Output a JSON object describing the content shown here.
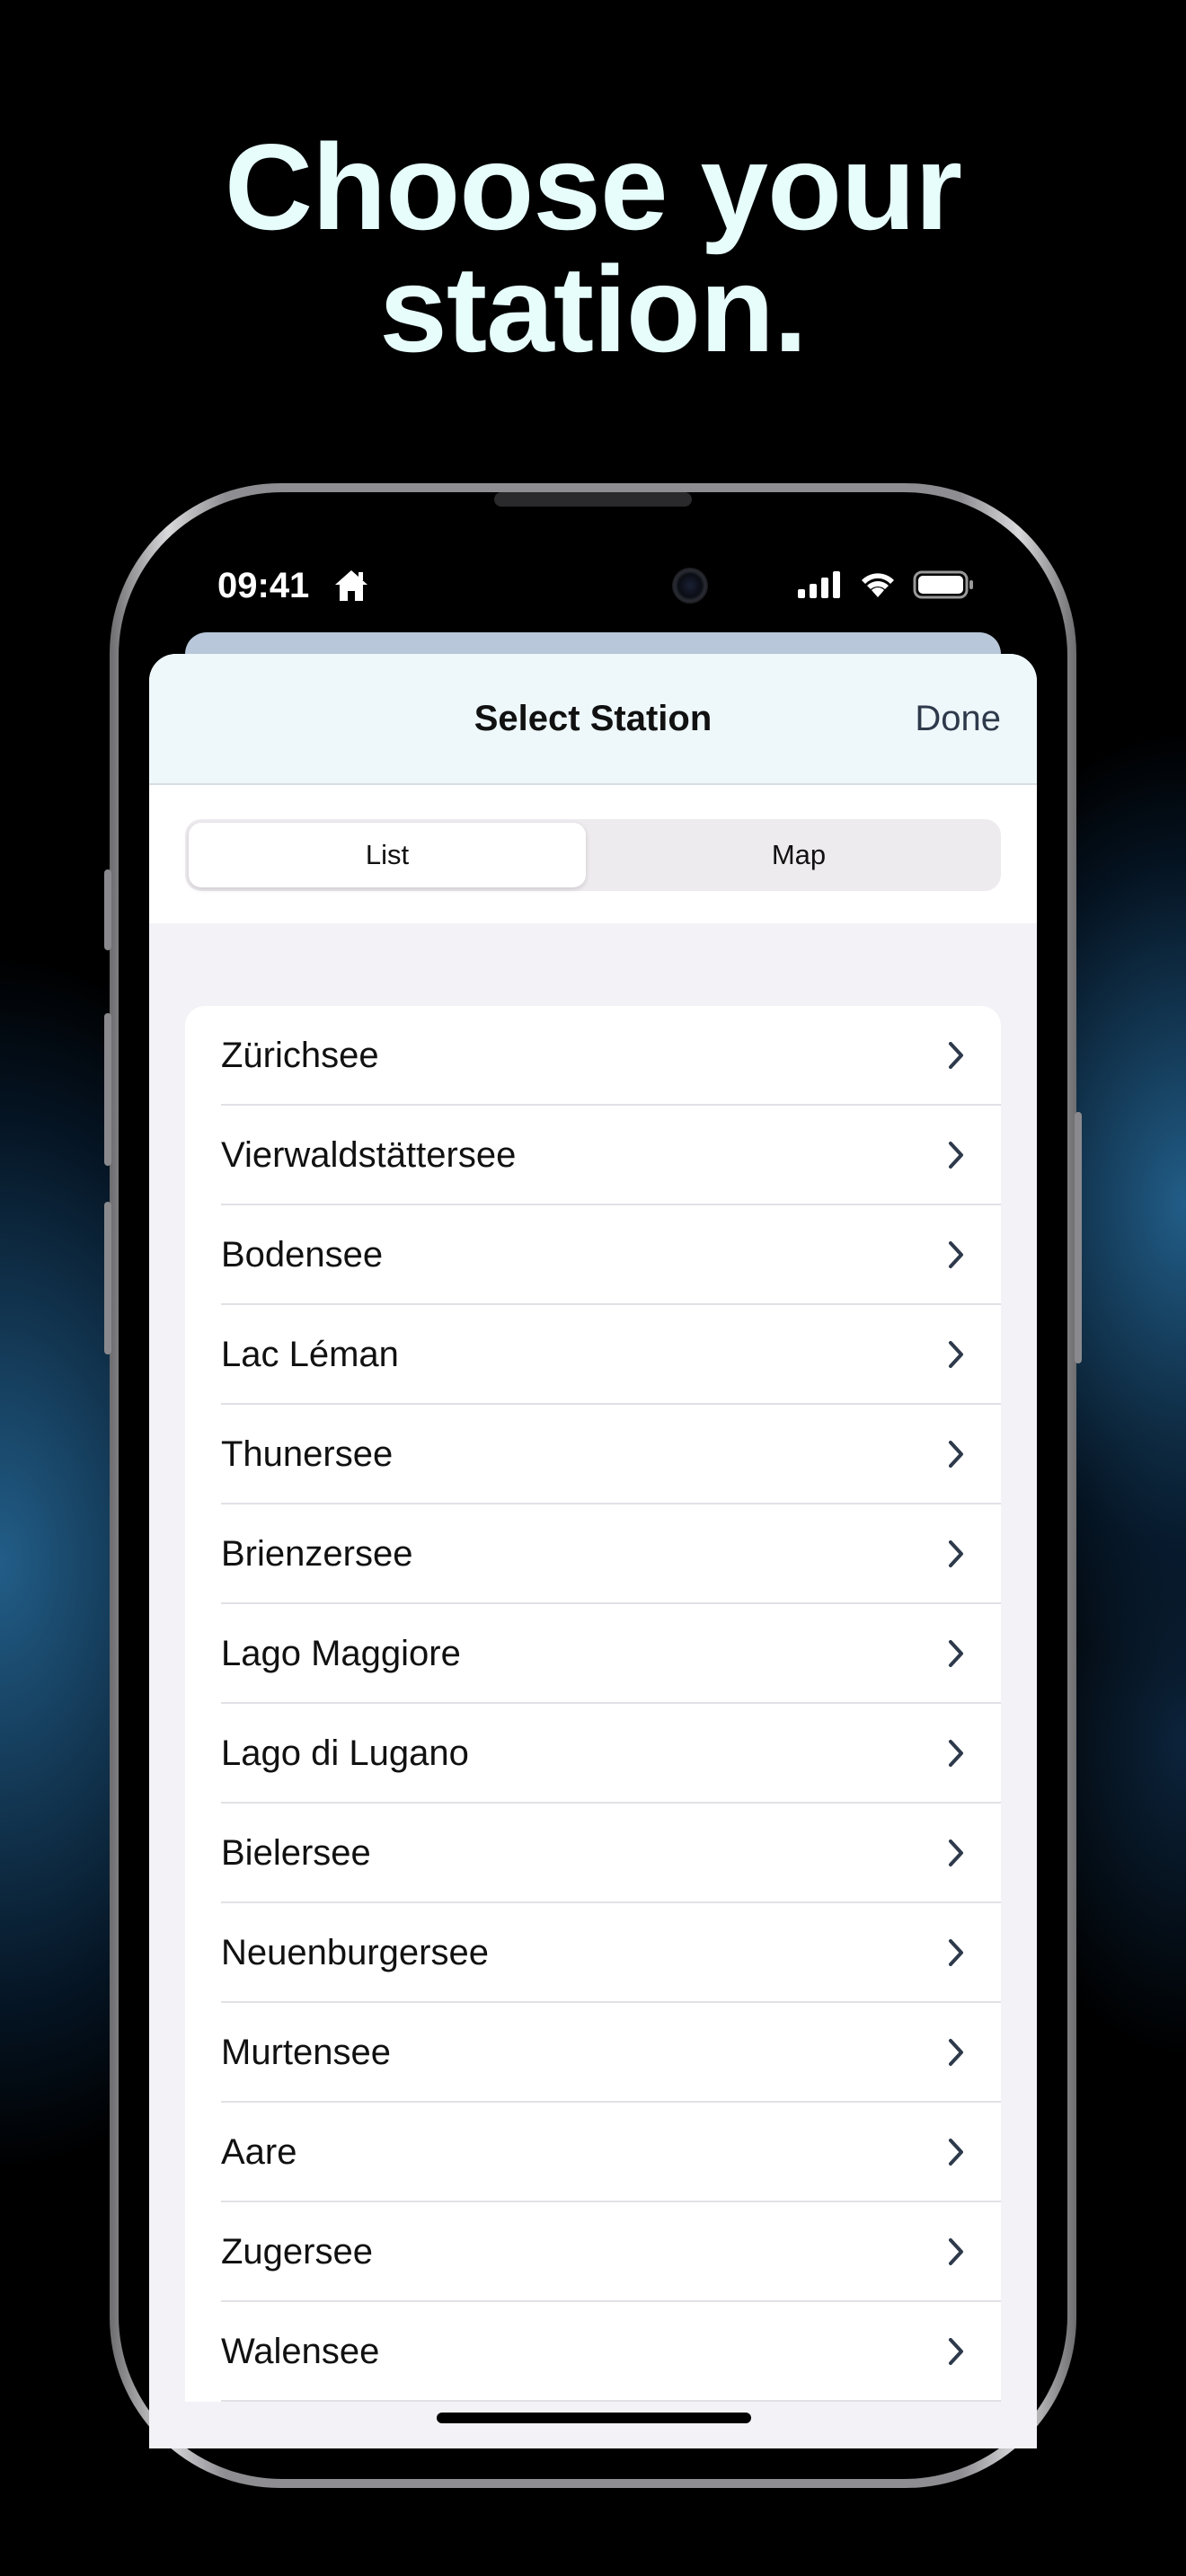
{
  "headline": {
    "line1": "Choose your",
    "line2": "station."
  },
  "status_bar": {
    "time": "09:41",
    "home_icon": "house-icon",
    "signal_icon": "cellular-signal-icon",
    "wifi_icon": "wifi-icon",
    "battery_icon": "battery-icon"
  },
  "sheet": {
    "title": "Select Station",
    "done_label": "Done"
  },
  "segmented": {
    "options": [
      "List",
      "Map"
    ],
    "selected": "List"
  },
  "stations": [
    "Zürichsee",
    "Vierwaldstättersee",
    "Bodensee",
    "Lac Léman",
    "Thunersee",
    "Brienzersee",
    "Lago Maggiore",
    "Lago di Lugano",
    "Bielersee",
    "Neuenburgersee",
    "Murtensee",
    "Aare",
    "Zugersee",
    "Walensee"
  ],
  "colors": {
    "headline": "#e6fdfb",
    "header_bg": "#eef8fb",
    "list_bg": "#f2f2f7",
    "chevron": "#2e3a4b"
  }
}
